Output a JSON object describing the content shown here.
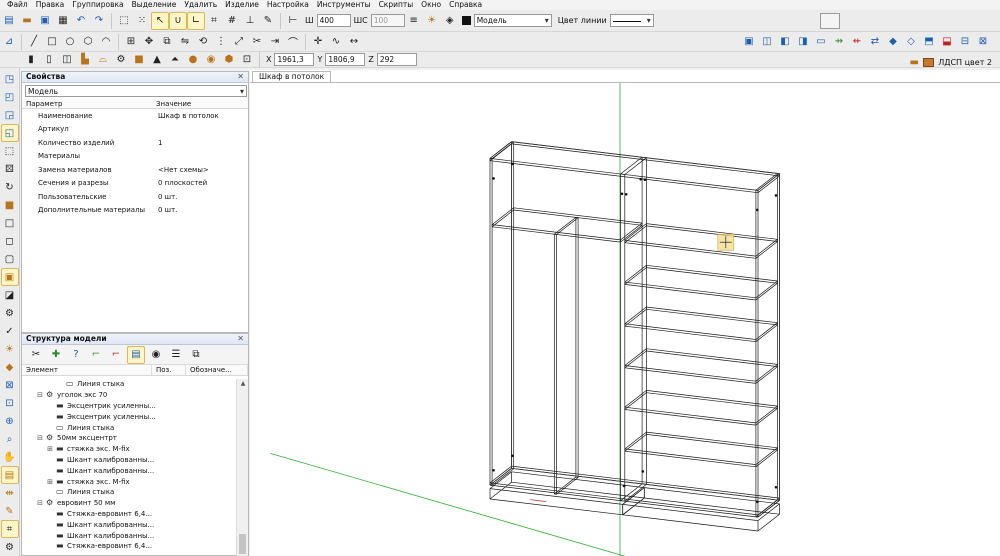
{
  "menu": [
    "Файл",
    "Правка",
    "Группировка",
    "Выделение",
    "Удалить",
    "Изделие",
    "Настройка",
    "Инструменты",
    "Скрипты",
    "Окно",
    "Справка"
  ],
  "toolbar": {
    "width_label": "Ш",
    "width_value": "400",
    "depth_label": "ШС",
    "depth_value": "100",
    "layer_value": "Модель",
    "line_color_label": "Цвет линии"
  },
  "coords": {
    "x_label": "X",
    "x_value": "1961,3",
    "y_label": "Y",
    "y_value": "1806,9",
    "z_label": "Z",
    "z_value": "292"
  },
  "material": {
    "label": "ЛДСП цвет 2",
    "color": "#c8772e"
  },
  "properties": {
    "title": "Свойства",
    "selector": "Модель",
    "col_param": "Параметр",
    "col_value": "Значение",
    "rows": [
      {
        "key": "Наименование",
        "value": "Шкаф в потолок"
      },
      {
        "key": "Артикул",
        "value": ""
      },
      {
        "key": "Количество изделий",
        "value": "1"
      },
      {
        "key": "Материалы",
        "value": ""
      },
      {
        "key": "Замена материалов",
        "value": "<Нет схемы>"
      },
      {
        "key": "Сечения и разрезы",
        "value": "0 плоскостей"
      },
      {
        "key": "Пользовательские",
        "value": "0 шт."
      },
      {
        "key": "Дополнительные материалы",
        "value": "0 шт."
      }
    ]
  },
  "structure": {
    "title": "Структура модели",
    "col_element": "Элемент",
    "col_pos": "Поз.",
    "col_desig": "Обозначе...",
    "items": [
      {
        "indent": 3,
        "exp": "",
        "icon": "doc",
        "label": "Линия стыка"
      },
      {
        "indent": 1,
        "exp": "⊟",
        "icon": "group",
        "label": "уголок экс 70"
      },
      {
        "indent": 2,
        "exp": "",
        "icon": "part",
        "label": "Эксцентрик усиленны..."
      },
      {
        "indent": 2,
        "exp": "",
        "icon": "part",
        "label": "Эксцентрик усиленны..."
      },
      {
        "indent": 2,
        "exp": "",
        "icon": "doc",
        "label": "Линия стыка"
      },
      {
        "indent": 1,
        "exp": "⊟",
        "icon": "group",
        "label": "50мм эксцентрт"
      },
      {
        "indent": 2,
        "exp": "⊞",
        "icon": "part",
        "label": "стяжка экс. M-fix"
      },
      {
        "indent": 2,
        "exp": "",
        "icon": "part",
        "label": "Шкант калиброванны..."
      },
      {
        "indent": 2,
        "exp": "",
        "icon": "part",
        "label": "Шкант калиброванны..."
      },
      {
        "indent": 2,
        "exp": "⊞",
        "icon": "part",
        "label": "стяжка экс. M-fix"
      },
      {
        "indent": 2,
        "exp": "",
        "icon": "doc",
        "label": "Линия стыка"
      },
      {
        "indent": 1,
        "exp": "⊟",
        "icon": "group",
        "label": "евровинт 50 мм"
      },
      {
        "indent": 2,
        "exp": "",
        "icon": "part",
        "label": "Стяжка-евровинт 6,4..."
      },
      {
        "indent": 2,
        "exp": "",
        "icon": "part",
        "label": "Шкант калиброванны..."
      },
      {
        "indent": 2,
        "exp": "",
        "icon": "part",
        "label": "Шкант калиброванны..."
      },
      {
        "indent": 2,
        "exp": "",
        "icon": "part",
        "label": "Стяжка-евровинт 6,4..."
      }
    ]
  },
  "viewport": {
    "tab": "Шкаф в потолок",
    "axis_green": "#2bb32b",
    "axis_red": "#d22020"
  }
}
